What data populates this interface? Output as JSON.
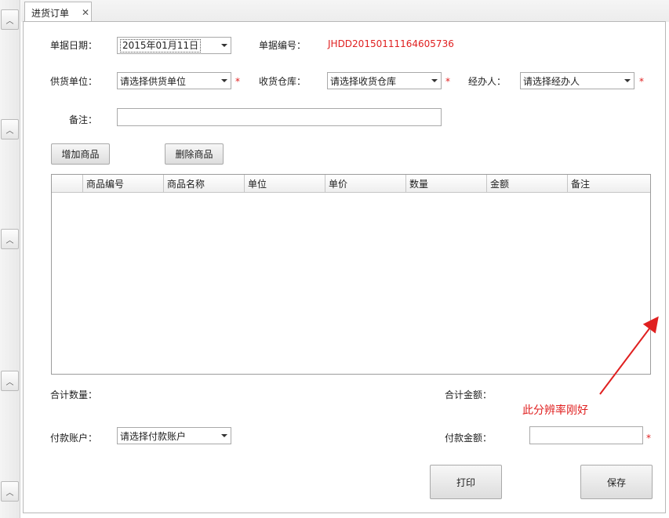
{
  "tab": {
    "title": "进货订单"
  },
  "form": {
    "date_label": "单据日期：",
    "date_value": "2015年01月11日",
    "doc_no_label": "单据编号：",
    "doc_no_value": "JHDD20150111164605736",
    "supplier_label": "供货单位：",
    "supplier_placeholder": "请选择供货单位",
    "warehouse_label": "收货仓库：",
    "warehouse_placeholder": "请选择收货仓库",
    "handler_label": "经办人：",
    "handler_placeholder": "请选择经办人",
    "remark_label": "备注：",
    "remark_value": "",
    "required_mark": "*"
  },
  "toolbar": {
    "add_label": "增加商品",
    "delete_label": "删除商品"
  },
  "grid": {
    "columns": [
      "商品编号",
      "商品名称",
      "单位",
      "单价",
      "数量",
      "金额",
      "备注"
    ],
    "rows": []
  },
  "footer": {
    "total_qty_label": "合计数量：",
    "total_qty_value": "",
    "total_amount_label": "合计金额：",
    "total_amount_value": "",
    "account_label": "付款账户：",
    "account_placeholder": "请选择付款账户",
    "payment_label": "付款金额：",
    "payment_value": "",
    "print_label": "打印",
    "save_label": "保存"
  },
  "annotation": {
    "text": "此分辨率刚好"
  },
  "colors": {
    "required": "#e02020",
    "doc_no": "#e02020",
    "annotation": "#e02020"
  },
  "icons": {
    "collapse": "chevron-up-icon",
    "dropdown": "chevron-down-icon",
    "close": "close-icon"
  }
}
